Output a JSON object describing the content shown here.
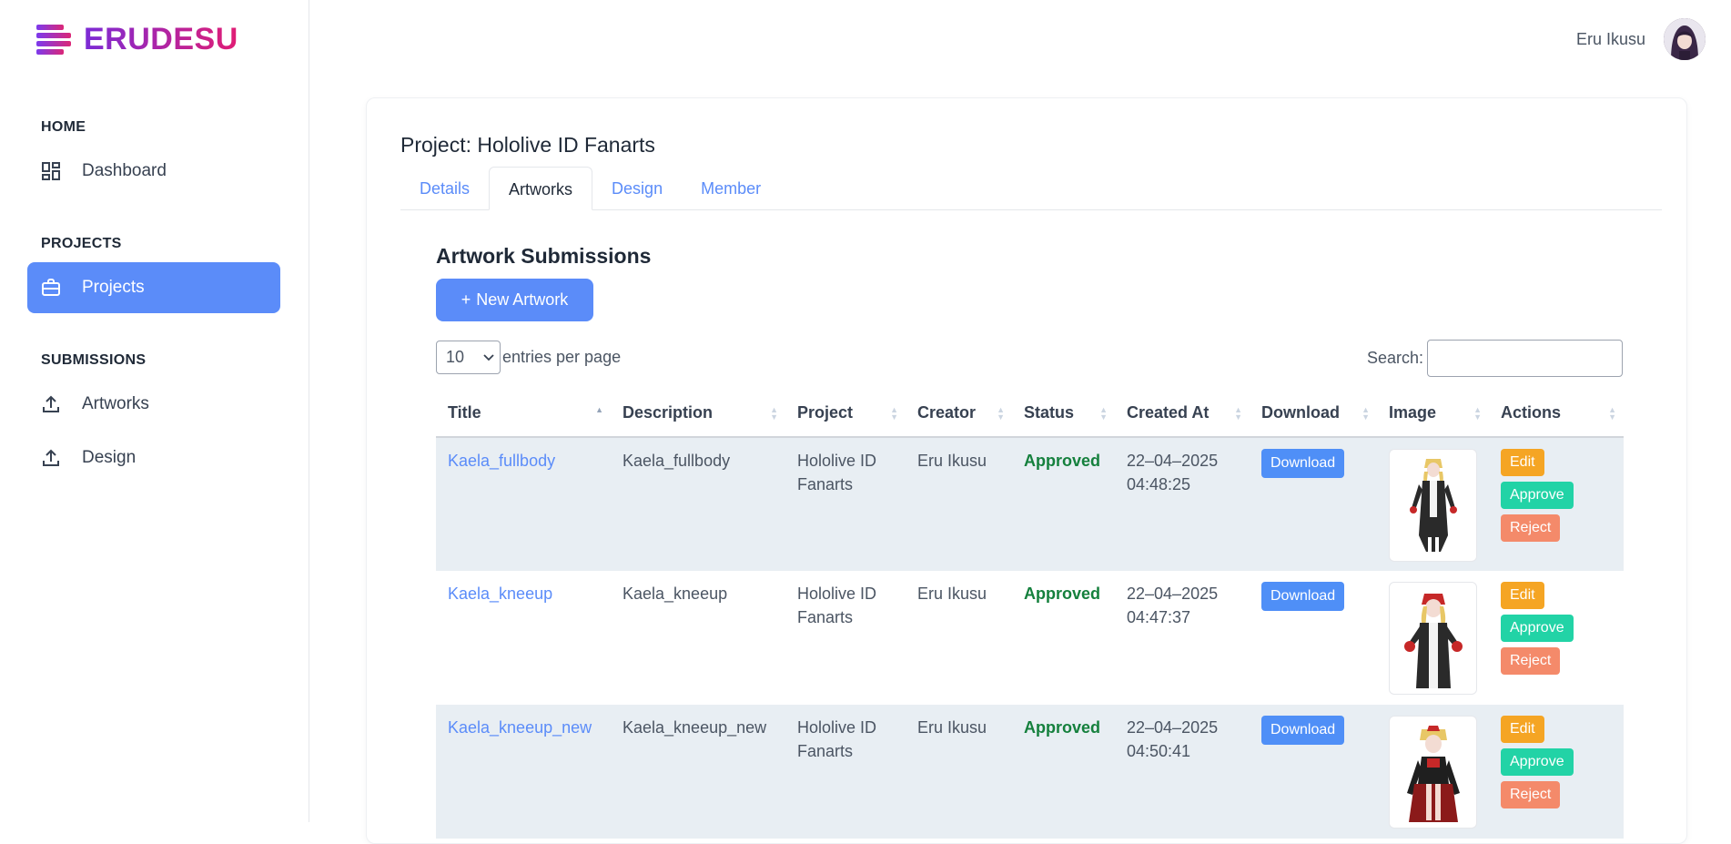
{
  "brand": {
    "name": "ERUDESU"
  },
  "user": {
    "name": "Eru Ikusu"
  },
  "sidebar": {
    "sections": [
      {
        "label": "HOME",
        "items": [
          {
            "label": "Dashboard",
            "icon": "dashboard-icon"
          }
        ]
      },
      {
        "label": "PROJECTS",
        "items": [
          {
            "label": "Projects",
            "icon": "briefcase-icon",
            "active": true
          }
        ]
      },
      {
        "label": "SUBMISSIONS",
        "items": [
          {
            "label": "Artworks",
            "icon": "upload-icon"
          },
          {
            "label": "Design",
            "icon": "upload-icon"
          }
        ]
      }
    ]
  },
  "page": {
    "title": "Project: Hololive ID Fanarts"
  },
  "tabs": [
    {
      "label": "Details"
    },
    {
      "label": "Artworks",
      "active": true
    },
    {
      "label": "Design"
    },
    {
      "label": "Member"
    }
  ],
  "section": {
    "title": "Artwork Submissions",
    "new_button": "New Artwork"
  },
  "table_controls": {
    "entries_value": "10",
    "entries_label": "entries per page",
    "search_label": "Search:"
  },
  "table": {
    "columns": [
      "Title",
      "Description",
      "Project",
      "Creator",
      "Status",
      "Created At",
      "Download",
      "Image",
      "Actions"
    ],
    "rows": [
      {
        "title": "Kaela_fullbody",
        "description": "Kaela_fullbody",
        "project_line1": "Hololive ID",
        "project_line2": "Fanarts",
        "creator": "Eru Ikusu",
        "status": "Approved",
        "date": "22–04–2025",
        "time": "04:48:25"
      },
      {
        "title": "Kaela_kneeup",
        "description": "Kaela_kneeup",
        "project_line1": "Hololive ID",
        "project_line2": "Fanarts",
        "creator": "Eru Ikusu",
        "status": "Approved",
        "date": "22–04–2025",
        "time": "04:47:37"
      },
      {
        "title": "Kaela_kneeup_new",
        "description": "Kaela_kneeup_new",
        "project_line1": "Hololive ID",
        "project_line2": "Fanarts",
        "creator": "Eru Ikusu",
        "status": "Approved",
        "date": "22–04–2025",
        "time": "04:50:41"
      }
    ],
    "download_label": "Download",
    "action_labels": {
      "edit": "Edit",
      "approve": "Approve",
      "reject": "Reject"
    }
  },
  "colors": {
    "accent": "#5b8cf9",
    "approved": "#15803d",
    "edit": "#f5a524",
    "approve": "#22d3a6",
    "reject": "#f48a6a",
    "row_alt": "#e8eef3"
  }
}
